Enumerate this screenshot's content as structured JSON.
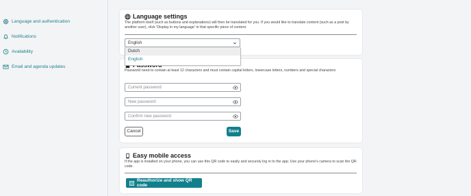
{
  "sidebar": {
    "items": [
      {
        "label": "Language and authentication",
        "icon": "gear-icon"
      },
      {
        "label": "Notifications",
        "icon": "bell-icon"
      },
      {
        "label": "Availability",
        "icon": "clock-icon"
      },
      {
        "label": "Email and agenda updates",
        "icon": "envelope-icon"
      }
    ]
  },
  "language": {
    "title": "Language settings",
    "description": "The platform itself (such as buttons and explanations) will then be translated for you. If you would like to translate content (such as a post by another user), click 'Display in my language' in that specific piece of content.",
    "selected": "English",
    "options": [
      "Dutch",
      "English"
    ]
  },
  "password": {
    "title": "Password",
    "description": "Password need to contain at least 12 characters and must contain capital letters, lowercase letters, numbers and special characters",
    "current_placeholder": "Current password",
    "new_placeholder": "New password",
    "confirm_placeholder": "Confirm new password",
    "cancel_label": "Cancel",
    "save_label": "Save"
  },
  "mobile": {
    "title": "Easy mobile access",
    "description": "If the app is installed on your phone, you can use this QR code to easily and securely log in to the app. Use your phone's camera to scan the QR code.",
    "button_label": "Reauthorize and show QR code"
  },
  "colors": {
    "accent": "#12808c",
    "link": "#1f7f8c",
    "background": "#f3f4f6"
  }
}
